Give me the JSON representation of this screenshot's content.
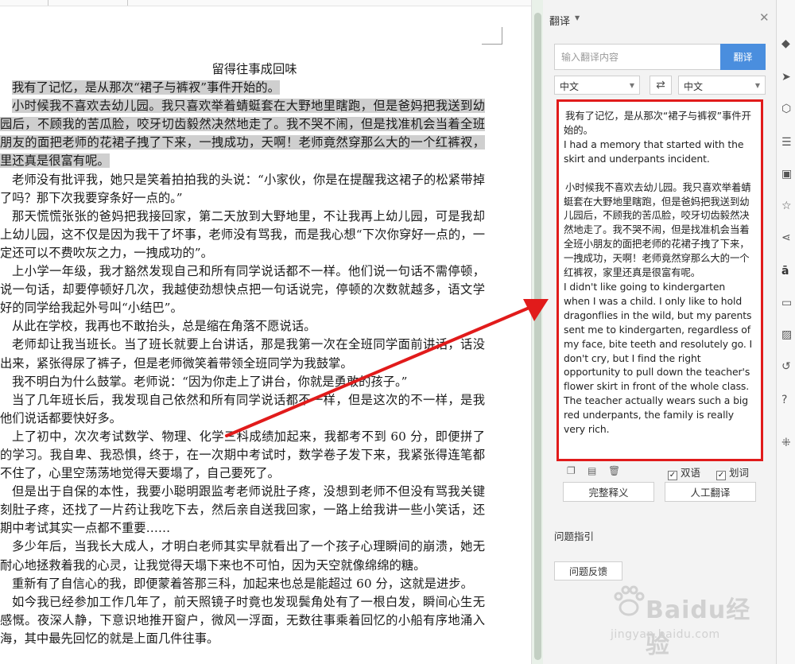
{
  "document": {
    "title": "留得往事成回味",
    "paragraphs": [
      {
        "text": "我有了记忆，是从那次“裙子与裤衩”事件开始的。",
        "highlight": true
      },
      {
        "text": "小时候我不喜欢去幼儿园。我只喜欢举着蜻蜓套在大野地里瞎跑，但是爸妈把我送到幼园后，不顾我的苦瓜脸，咬牙切齿毅然决然地走了。我不哭不闹，但是找准机会当着全班朋友的面把老师的花裙子拽了下来，一拽成功，天啊！老师竟然穿那么大的一个红裤衩，里还真是很富有呢。",
        "highlight": true
      },
      {
        "text": "老师没有批评我，她只是笑着拍拍我的头说：“小家伙，你是在提醒我这裙子的松紧带掉了吗？那下次我要穿条好一点的。”",
        "highlight": false
      },
      {
        "text": "那天慌慌张张的爸妈把我接回家，第二天放到大野地里，不让我再上幼儿园，可是我却上幼儿园，这不仅是因为我干了坏事，老师没有骂我，而是我心想“下次你穿好一点的，一定还可以不费吹灰之力，一拽成功的”。",
        "highlight": false
      },
      {
        "text": "上小学一年级，我才豁然发现自己和所有同学说话都不一样。他们说一句话不需停顿，说一句话，却要停顿好几次，我越使劲想快点把一句话说完，停顿的次数就越多，语文学好的同学给我起外号叫“小结巴”。",
        "highlight": false
      },
      {
        "text": "从此在学校，我再也不敢抬头，总是缩在角落不愿说话。",
        "highlight": false
      },
      {
        "text": "老师却让我当班长。当了班长就要上台讲话，那是我第一次在全班同学面前讲话，话没出来，紧张得尿了裤子，但是老师微笑着带领全班同学为我鼓掌。",
        "highlight": false
      },
      {
        "text": "我不明白为什么鼓掌。老师说：“因为你走上了讲台，你就是勇敢的孩子。”",
        "highlight": false
      },
      {
        "text": "当了几年班长后，我发现自己依然和所有同学说话都不一样，但是这次的不一样，是我他们说话都要快好多。",
        "highlight": false
      },
      {
        "text": "上了初中，次次考试数学、物理、化学三科成绩加起来，我都考不到 60 分，即便拼了的学习。我自卑、我恐惧，终于，在一次期中考试时，数学卷子发下来，我紧张得连笔都不住了，心里空荡荡地觉得天要塌了，自己要死了。",
        "highlight": false
      },
      {
        "text": "但是出于自保的本性，我要小聪明跟监考老师说肚子疼，没想到老师不但没有骂我关键刻肚子疼，还找了一片药让我吃下去，然后亲自送我回家，一路上给我讲一些小笑话，还期中考试其实一点都不重要……",
        "highlight": false
      },
      {
        "text": "多少年后，当我长大成人，才明白老师其实早就看出了一个孩子心理瞬间的崩溃，她无耐心地拯救着我的心灵，让我觉得天塌下来也不可怕，因为天空就像绵绵的糖。",
        "highlight": false
      },
      {
        "text": "重新有了自信心的我，即便蒙着答那三科，加起来也总是能超过 60 分，这就是进步。",
        "highlight": false
      },
      {
        "text": "如今我已经参加工作几年了，前天照镜子时竟也发现鬓角处有了一根白发，瞬间心生无感慨。夜深人静，下意识地推开窗户，微风一浮面，无数往事乘着回忆的小船有序地涌入海，其中最先回忆的就是上面几件往事。",
        "highlight": false
      }
    ]
  },
  "panel": {
    "title": "翻译",
    "input_placeholder": "输入翻译内容",
    "translate_button": "翻译",
    "source_language": "中文",
    "target_language": "中文",
    "result": [
      {
        "lang": "zh",
        "text": "我有了记忆，是从那次“裙子与裤衩”事件开始的。"
      },
      {
        "lang": "en",
        "text": "I had a memory that started with the skirt and underpants incident."
      },
      {
        "lang": "gap",
        "text": ""
      },
      {
        "lang": "zh",
        "text": "小时候我不喜欢去幼儿园。我只喜欢举着蜻蜓套在大野地里瞎跑，但是爸妈把我送到幼儿园后，不顾我的苦瓜脸，咬牙切齿毅然决然地走了。我不哭不闹，但是找准机会当着全班小朋友的面把老师的花裙子拽了下来，一拽成功，天啊！老师竟然穿那么大的一个红裤衩，家里还真是很富有呢。"
      },
      {
        "lang": "en",
        "text": "I didn't like going to kindergarten when I was a child. I only like to hold dragonflies in the wild, but my parents sent me to kindergarten, regardless of my face, bite teeth and resolutely go. I don't cry, but I find the right opportunity to pull down the teacher's flower skirt in front of the whole class. The teacher actually wears such a big red underpants, the family is really very rich."
      }
    ],
    "checkbox_bilingual": "双语",
    "checkbox_mark": "划词",
    "full_definition_button": "完整释义",
    "human_translation_button": "人工翻译",
    "help_title": "问题指引",
    "feedback_button": "问题反馈"
  },
  "watermark": {
    "text": "Baidu经验",
    "sub": "jingyan.baidu.com"
  },
  "colors": {
    "accent": "#4a8ede",
    "annotation": "#e11b1b",
    "highlight": "#cfcfcf"
  }
}
